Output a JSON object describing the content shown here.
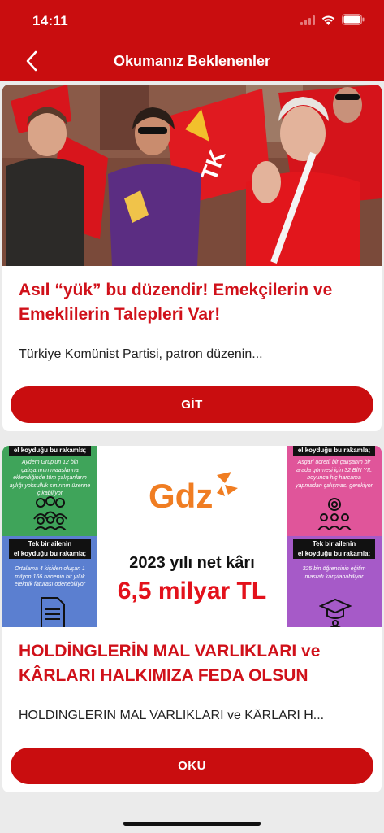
{
  "status_bar": {
    "time": "14:11"
  },
  "nav": {
    "title": "Okumanız Beklenenler"
  },
  "cards": [
    {
      "title": "Asıl “yük” bu düzendir! Emekçilerin ve Emeklilerin Talepleri Var!",
      "excerpt": "Türkiye Komünist Partisi, patron düzenin...",
      "button_label": "GİT"
    },
    {
      "title": "HOLDİNGLERİN MAL VARLIKLARI ve KÂRLARI HALKIMIZA FEDA OLSUN",
      "excerpt": "HOLDİNGLERİN MAL VARLIKLARI ve KÂRLARI H...",
      "button_label": "OKU",
      "infographic": {
        "logo": "Gdz",
        "net_label": "2023 yılı net kârı",
        "net_value": "6,5 milyar TL",
        "top_left_head": "el koyduğu bu rakamla;",
        "top_left_text": "Aydem Grup'un 12 bin çalışanının maaşlarına eklendiğinde tüm çalışanların aylığı yoksulluk sınırının üzerine çıkabiliyor",
        "bottom_left_head_1": "Tek bir ailenin",
        "bottom_left_head_2": "el koyduğu bu rakamla;",
        "bottom_left_text": "Ortalama 4 kişiden oluşan 1 milyon 166 hanenin bir yıllık elektrik faturası ödenebiliyor",
        "top_right_head": "el koyduğu bu rakamla;",
        "top_right_text": "Asgari ücretli bir çalışanın bir arada görmesi için 32 BİN YIL boyunca hiç harcama yapmadan çalışması gerekiyor",
        "bottom_right_head_1": "Tek bir ailenin",
        "bottom_right_head_2": "el koyduğu bu rakamla;",
        "bottom_right_text": "325 bin öğrencinin eğitim masrafı karşılanabiliyor",
        "colors": {
          "green": "#3fa45a",
          "blue": "#5b7fd0",
          "pink": "#e0559a",
          "purple": "#a65ac8",
          "red": "#e3111b",
          "orange": "#f07d22"
        }
      }
    }
  ],
  "colors": {
    "brand_red": "#c90d0f",
    "title_red": "#d0111a",
    "background": "#ebebeb"
  }
}
